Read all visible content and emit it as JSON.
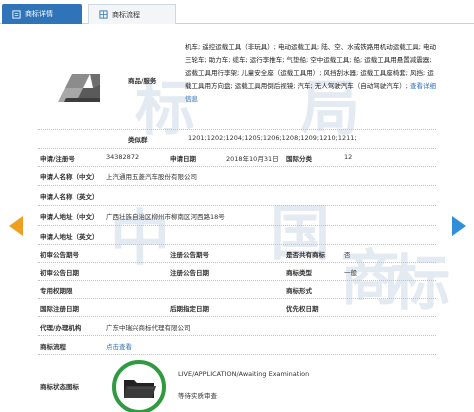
{
  "tabs": [
    {
      "label": "商标详情",
      "active": true
    },
    {
      "label": "商标流程",
      "active": false
    }
  ],
  "goods": {
    "label": "商品/服务",
    "text": "机车; 遥控运载工具（非玩具）; 电动运载工具; 陆、空、水或铁路用机动运载工具; 电动三轮车; 助力车; 缆车; 运行李推车; 气垫船; 空中运载工具; 船; 运载工具用悬置减震器; 运载工具用行李架; 儿童安全座（运载工具用）; 风挡刮水器; 运载工具座椅套; 风挡; 运载工具用方向盘; 运载工具用倒后视镜; 汽车; 无人驾驶汽车（自动驾驶汽车）; ",
    "more": "查看详细信息"
  },
  "group": {
    "label": "类似群",
    "value": "1201;1202;1204;1205;1206;1208;1209;1210;1211;"
  },
  "fields": {
    "app_no_label": "申请/注册号",
    "app_no": "34382872",
    "app_date_label": "申请日期",
    "app_date": "2018年10月31日",
    "intl_class_label": "国际分类",
    "intl_class": "12",
    "applicant_cn_label": "申请人名称（中文）",
    "applicant_cn": "上汽通用五菱汽车股份有限公司",
    "applicant_en_label": "申请人名称（英文）",
    "applicant_en": "",
    "address_cn_label": "申请人地址（中文）",
    "address_cn": "广西壮族自治区柳州市柳南区河西路18号",
    "address_en_label": "申请人地址（英文）",
    "address_en": "",
    "prelim_no_label": "初审公告期号",
    "prelim_no": "",
    "reg_no_label": "注册公告期号",
    "reg_no": "",
    "shared_label": "是否共有商标",
    "shared": "否",
    "prelim_date_label": "初审公告日期",
    "prelim_date": "",
    "reg_date_label": "注册公告日期",
    "reg_date": "",
    "type_label": "商标类型",
    "type": "一般",
    "exclusive_label": "专用权期限",
    "exclusive": "",
    "form_label": "商标形式",
    "form": "",
    "intl_reg_label": "国际注册日期",
    "intl_reg": "",
    "late_label": "后期指定日期",
    "late": "",
    "priority_label": "优先权日期",
    "priority": "",
    "agent_label": "代理/办理机构",
    "agent": "广东中瑞兴商标代理有限公司",
    "flow_label": "商标流程",
    "flow_link": "点击查看",
    "status_label": "商标状态图标",
    "status_text": "LIVE/APPLICATION/Awaiting Examination",
    "status_sub": "等待实质审查"
  },
  "watermarks": [
    "标",
    "局",
    "中",
    "国",
    "商",
    "标"
  ],
  "colors": {
    "tab_active": "#2f73b8",
    "link": "#2f73b8",
    "prev_arrow": "#f0a020",
    "next_arrow": "#2f8fd8",
    "status_ring": "#2f9a3f"
  }
}
